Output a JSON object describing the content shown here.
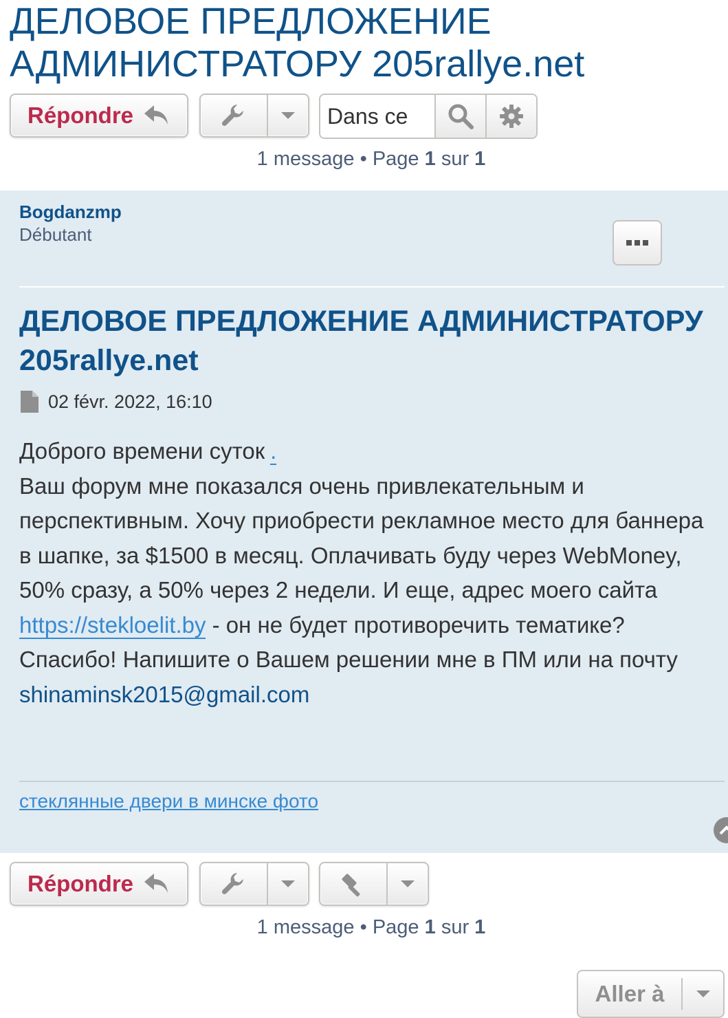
{
  "topic": {
    "title": "ДЕЛОВОЕ ПРЕДЛОЖЕНИЕ АДМИНИСТРАТОРУ 205rallye.net"
  },
  "action_bar": {
    "reply_label": "Répondre",
    "search_placeholder": "Dans ce"
  },
  "pagination": {
    "count_text": "1 message",
    "separator": "•",
    "page_word": "Page",
    "current_page": "1",
    "of_word": "sur",
    "total_pages": "1"
  },
  "post": {
    "author": "Bogdanzmp",
    "rank": "Débutant",
    "title": "ДЕЛОВОЕ ПРЕДЛОЖЕНИЕ АДМИНИСТРАТОРУ 205rallye.net",
    "date": "02 févr. 2022, 16:10",
    "body": {
      "line1": "Доброго времени суток",
      "dot_link": ".",
      "para2_before_link": "Ваш форум мне показался очень привлекательным и перспективным. Хочу приобрести рекламное место для баннера в шапке, за $1500 в месяц. Оплачивать буду через WebMoney, 50% сразу, а 50% через 2 недели. И еще, адрес моего сайта",
      "site_link": "https://stekloelit.by",
      "para2_after_link": "- он не будет противоречить тематике?",
      "para3_before_email": "Спасибо! Напишите о Вашем решении мне в ПМ или на почту",
      "email": "shinaminsk2015@gmail.com"
    },
    "signature_link": "стеклянные двери в минске фото"
  },
  "jumpbox": {
    "label": "Aller à"
  },
  "icons": {
    "reply": "reply-arrow-icon",
    "tools": "wrench-icon",
    "caret": "caret-down-icon",
    "search": "magnifier-icon",
    "advanced_search": "gear-icon",
    "post_menu": "ellipsis-icon",
    "post_document": "document-icon",
    "moderator": "gavel-icon",
    "back_to_top": "chevron-up-icon"
  },
  "colors": {
    "link": "#105289",
    "reply_text": "#bc2a4d",
    "post_background": "#e1ebf2",
    "url_link": "#368ad2"
  }
}
